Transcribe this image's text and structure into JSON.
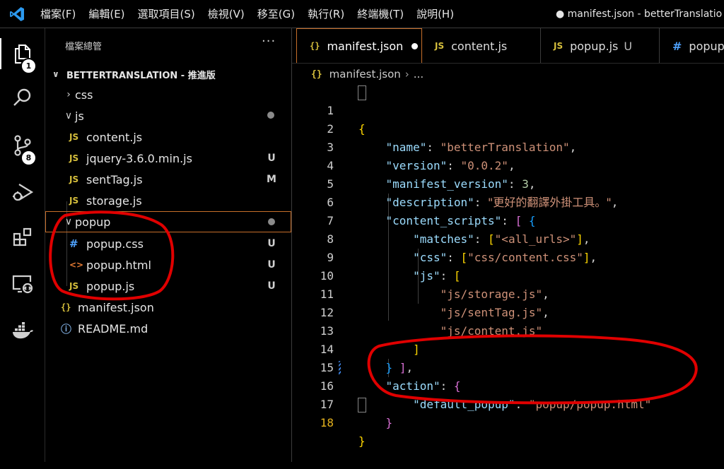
{
  "menu": {
    "items": [
      "檔案(F)",
      "編輯(E)",
      "選取項目(S)",
      "檢視(V)",
      "移至(G)",
      "執行(R)",
      "終端機(T)",
      "說明(H)"
    ]
  },
  "window_title": "● manifest.json - betterTranslatio",
  "activity_bar": {
    "items": [
      "explorer-icon",
      "search-icon",
      "source-control-icon",
      "run-debug-icon",
      "extensions-icon",
      "remote-explorer-icon",
      "docker-icon"
    ],
    "explorer_badge": "1",
    "source_control_badge": "8"
  },
  "sidebar": {
    "header": "檔案總管",
    "more": "···",
    "project": "BETTERTRANSLATION - 推進版",
    "tree": [
      {
        "name": "css",
        "kind": "folder",
        "expanded": false
      },
      {
        "name": "js",
        "kind": "folder",
        "expanded": true
      },
      {
        "name": "content.js",
        "icon": "JS",
        "status": ""
      },
      {
        "name": "jquery-3.6.0.min.js",
        "icon": "JS",
        "status": "U"
      },
      {
        "name": "sentTag.js",
        "icon": "JS",
        "status": "M"
      },
      {
        "name": "storage.js",
        "icon": "JS",
        "status": ""
      },
      {
        "name": "popup",
        "kind": "folder",
        "expanded": true
      },
      {
        "name": "popup.css",
        "icon": "#",
        "status": "U"
      },
      {
        "name": "popup.html",
        "icon": "<>",
        "status": "U"
      },
      {
        "name": "popup.js",
        "icon": "JS",
        "status": "U"
      },
      {
        "name": "manifest.json",
        "icon": "{}",
        "status": ""
      },
      {
        "name": "README.md",
        "icon": "ⓘ",
        "status": ""
      }
    ]
  },
  "tabs": [
    {
      "label": "manifest.json",
      "icon": "{}",
      "status": ""
    },
    {
      "label": "content.js",
      "icon": "JS",
      "status": ""
    },
    {
      "label": "popup.js",
      "icon": "JS",
      "status": "U"
    },
    {
      "label": "popup",
      "icon": "#",
      "status": ""
    }
  ],
  "breadcrumb": {
    "icon": "{}",
    "file": "manifest.json",
    "rest": "..."
  },
  "editor": {
    "line_numbers": [
      "1",
      "2",
      "3",
      "4",
      "5",
      "6",
      "7",
      "8",
      "9",
      "10",
      "11",
      "12",
      "13",
      "14",
      "15",
      "16",
      "17",
      "18"
    ],
    "current_line": "18",
    "code": {
      "name_key": "\"name\"",
      "name_val": "\"betterTranslation\"",
      "version_key": "\"version\"",
      "version_val": "\"0.0.2\"",
      "mv_key": "\"manifest_version\"",
      "mv_val": "3",
      "desc_key": "\"description\"",
      "desc_val": "\"更好的翻譯外掛工具。\"",
      "cs_key": "\"content_scripts\"",
      "matches_key": "\"matches\"",
      "matches_val": "\"<all_urls>\"",
      "css_key": "\"css\"",
      "css_val": "\"css/content.css\"",
      "js_key": "\"js\"",
      "js_1": "\"js/storage.js\"",
      "js_2": "\"js/sentTag.js\"",
      "js_3": "\"js/content.js\"",
      "action_key": "\"action\"",
      "popup_key": "\"default_popup\"",
      "popup_val": "\"popup/popup.html\""
    }
  },
  "colors": {
    "annotation": "#e00000",
    "accent": "#c76f2a"
  }
}
